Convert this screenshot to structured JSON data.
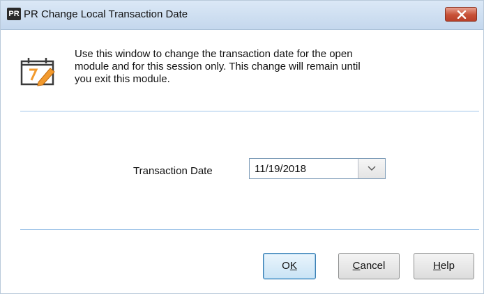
{
  "window": {
    "app_badge": "PR",
    "title": "PR Change Local Transaction Date"
  },
  "info": {
    "lines": [
      "Use this window to change the transaction date for the open",
      "module and for this session only. This change will remain until",
      "you exit this module."
    ]
  },
  "form": {
    "date_label": "Transaction Date",
    "date_value": "11/19/2018"
  },
  "buttons": {
    "ok": {
      "pre": "O",
      "key": "K",
      "post": ""
    },
    "cancel": {
      "pre": "",
      "key": "C",
      "post": "ancel"
    },
    "help": {
      "pre": "",
      "key": "H",
      "post": "elp"
    }
  },
  "colors": {
    "accent_orange": "#f29a2e",
    "close_red": "#c75036",
    "separator": "#9fc4e8"
  },
  "icons": {
    "close": "close-icon",
    "calendar": "calendar-edit-icon",
    "dropdown": "chevron-down-icon"
  }
}
